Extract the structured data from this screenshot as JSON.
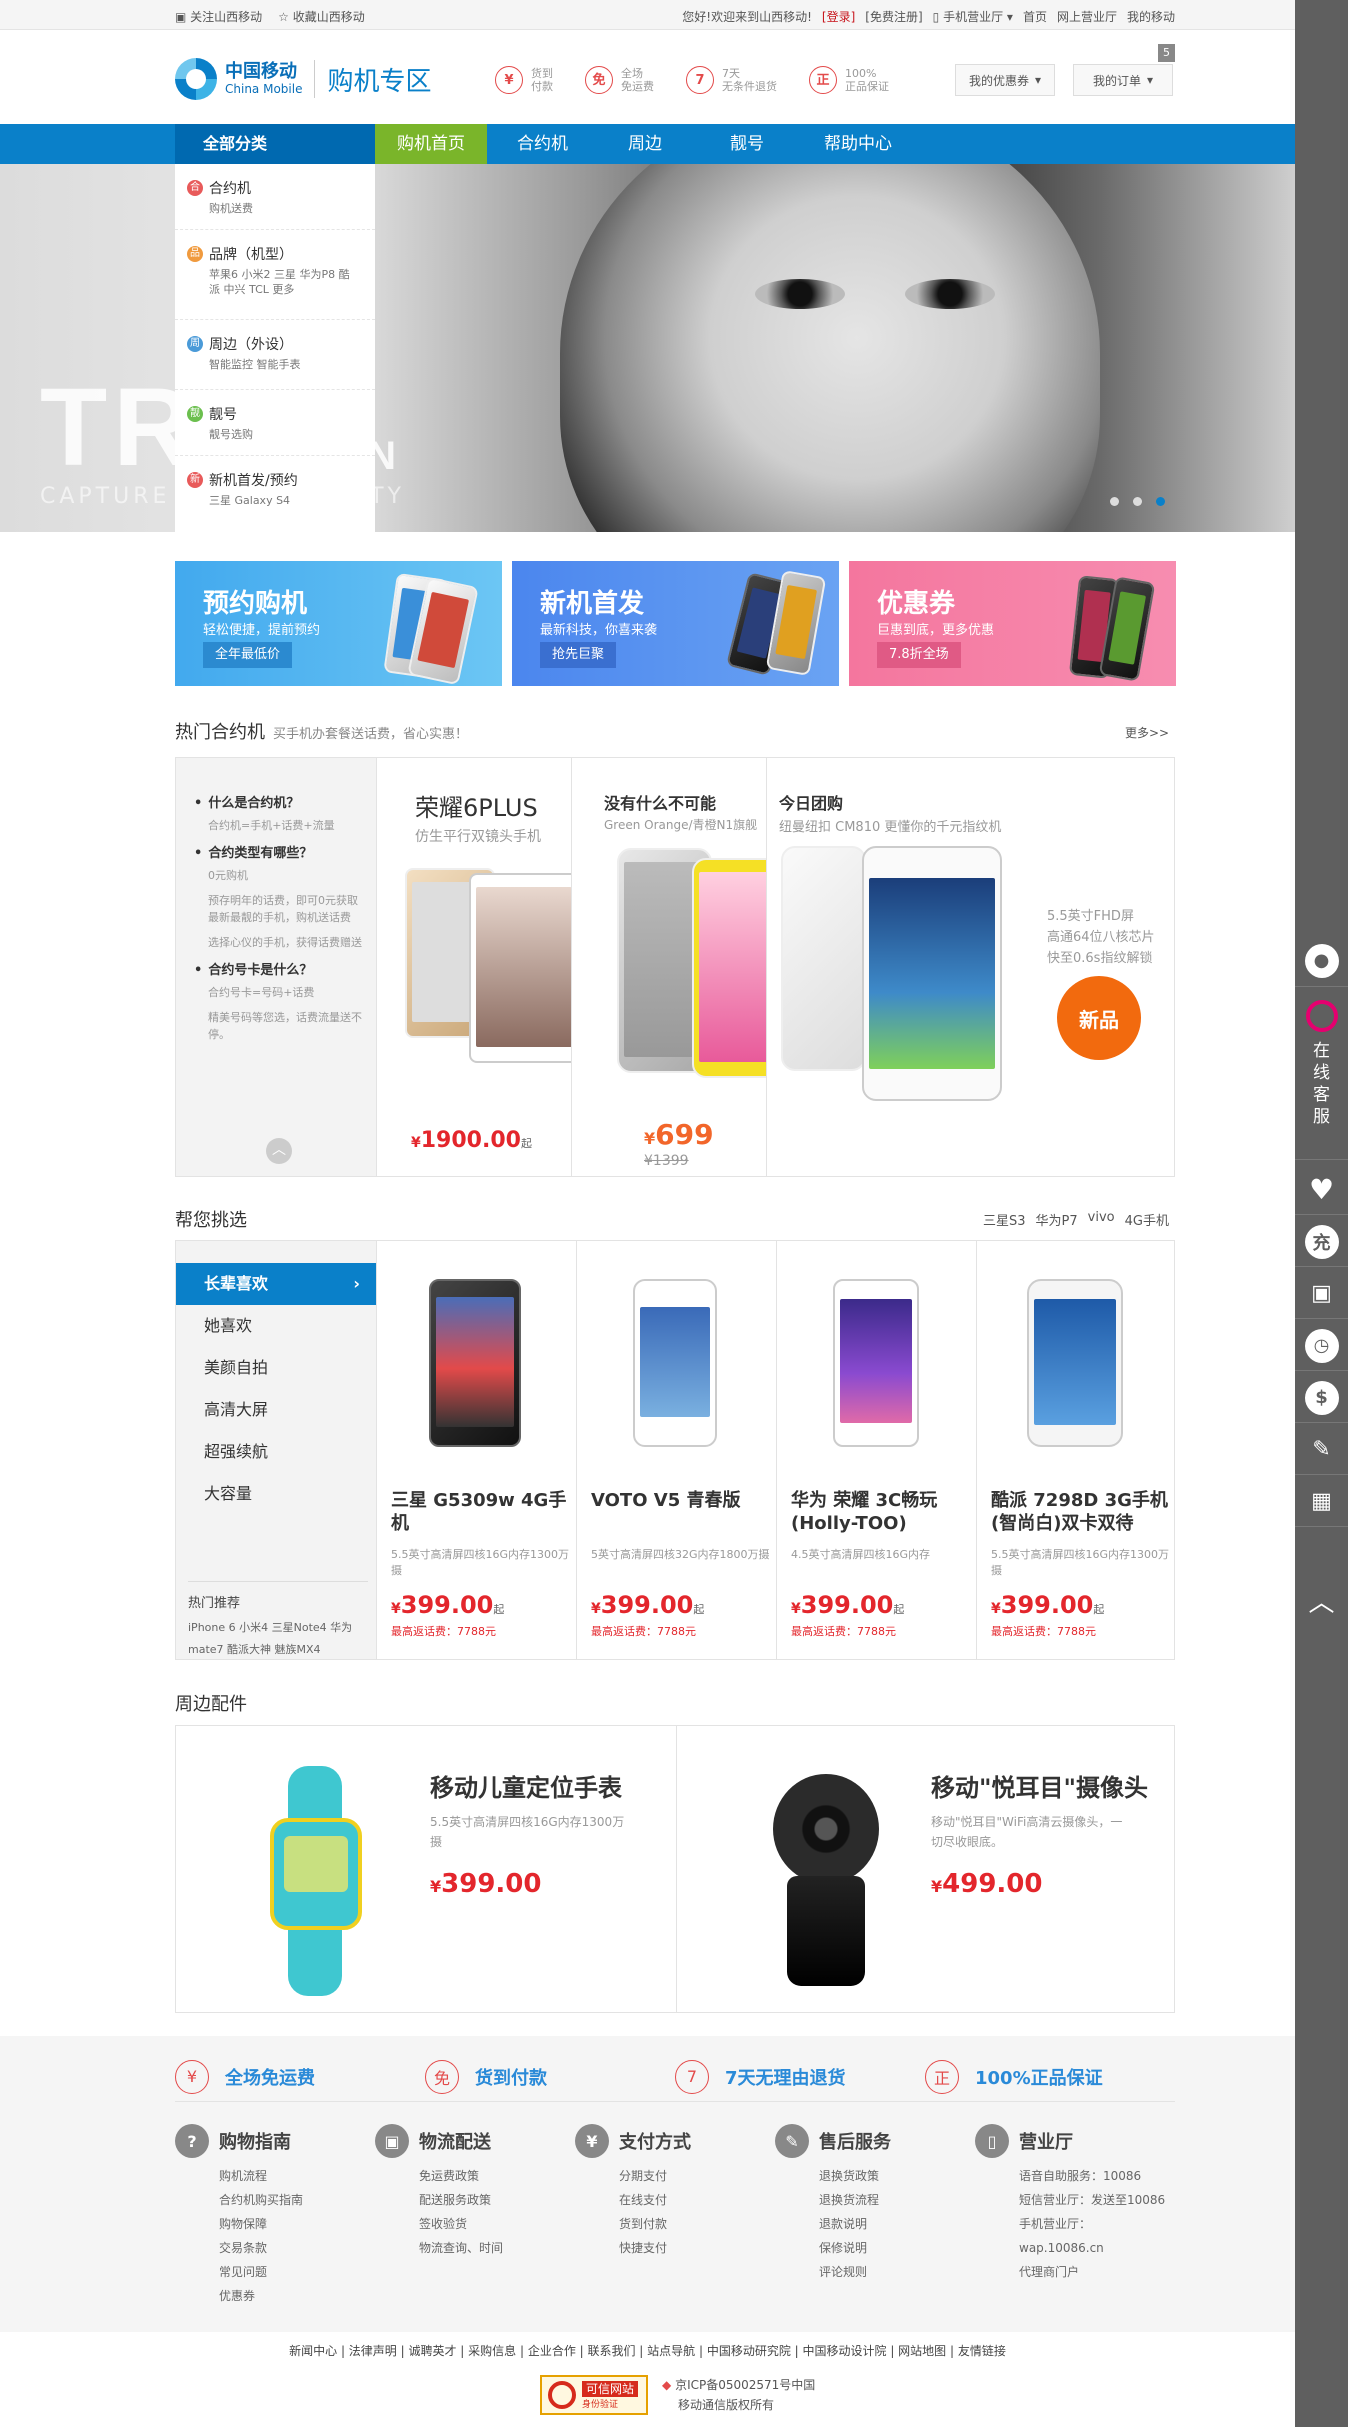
{
  "topbar": {
    "follow": "关注山西移动",
    "favorite": "收藏山西移动",
    "welcome": "您好!欢迎来到山西移动!",
    "login": "[登录]",
    "register": "[免费注册]",
    "mobile_hall": "手机营业厅",
    "home": "首页",
    "online_hall": "网上营业厅",
    "my_mobile": "我的移动"
  },
  "header": {
    "logo_cn": "中国移动",
    "logo_en": "China Mobile",
    "zone": "购机专区",
    "promos": [
      {
        "icon": "¥",
        "l1": "货到",
        "l2": "付款"
      },
      {
        "icon": "免",
        "l1": "全场",
        "l2": "免运费"
      },
      {
        "icon": "7",
        "l1": "7天",
        "l2": "无条件退货"
      },
      {
        "icon": "正",
        "l1": "100%",
        "l2": "正品保证"
      }
    ],
    "coupon_btn": "我的优惠券",
    "order_btn": "我的订单",
    "order_count": "5"
  },
  "nav": {
    "all": "全部分类",
    "items": [
      "购机首页",
      "合约机",
      "周边",
      "靓号",
      "帮助中心"
    ]
  },
  "categories": [
    {
      "icon": "合",
      "color": "#e85a5a",
      "title": "合约机",
      "sub": "购机送费"
    },
    {
      "icon": "品",
      "color": "#f09a3e",
      "title": "品牌（机型）",
      "sub": "苹果6 小米2 三星 华为P8 酷派 中兴 TCL 更多"
    },
    {
      "icon": "周",
      "color": "#4a9ad8",
      "title": "周边（外设）",
      "sub": "智能监控 智能手表"
    },
    {
      "icon": "靓",
      "color": "#6bbf4e",
      "title": "靓号",
      "sub": "靓号选购"
    },
    {
      "icon": "新",
      "color": "#e85a5a",
      "title": "新机首发/预约",
      "sub": "三星 Galaxy S4"
    }
  ],
  "banner": {
    "big": "TRU",
    "big2": "ON",
    "tag": "CAPTURE YO",
    "tag2": "UTY"
  },
  "promo_cards": [
    {
      "title": "预约购机",
      "sub": "轻松便捷，提前预约",
      "btn": "全年最低价"
    },
    {
      "title": "新机首发",
      "sub": "最新科技，你喜来袭",
      "btn": "抢先巨聚"
    },
    {
      "title": "优惠券",
      "sub": "巨惠到底，更多优惠",
      "btn": "7.8折全场"
    }
  ],
  "hot": {
    "title": "热门合约机",
    "subtitle": "买手机办套餐送话费，省心实惠！",
    "more": "更多>>",
    "faq": [
      {
        "q": "什么是合约机？",
        "a": [
          "合约机=手机+话费+流量"
        ]
      },
      {
        "q": "合约类型有哪些？",
        "a": [
          "0元购机",
          "预存明年的话费，即可0元获取最新最靓的手机，购机送话费",
          "选择心仪的手机，获得话费赠送"
        ]
      },
      {
        "q": "合约号卡是什么？",
        "a": [
          "合约号卡=号码+话费",
          "精美号码等您选，话费流量送不停。"
        ]
      }
    ],
    "p1": {
      "name": "荣耀6PLUS",
      "sub": "仿生平行双镜头手机",
      "price": "1900.00",
      "unit": "起"
    },
    "p2": {
      "title": "没有什么不可能",
      "sub": "Green Orange/青橙N1旗舰",
      "price": "699",
      "old": "1399"
    },
    "p3": {
      "title": "今日团购",
      "sub": "纽曼纽扣 CM810 更懂你的千元指纹机",
      "spec": [
        "5.5英寸FHD屏",
        "高通64位八核芯片",
        "快至0.6s指纹解锁"
      ],
      "badge": "新品"
    }
  },
  "pick": {
    "title": "帮您挑选",
    "tags": [
      "三星S3",
      "华为P7",
      "vivo",
      "4G手机"
    ],
    "tabs": [
      "长辈喜欢",
      "她喜欢",
      "美颜自拍",
      "高清大屏",
      "超强续航",
      "大容量"
    ],
    "rec_title": "热门推荐",
    "rec_items": "iPhone 6 小米4 三星Note4 华为mate7 酷派大神 魅族MX4",
    "items": [
      {
        "name": "三星 G5309w 4G手机",
        "desc": "5.5英寸高清屏四核16G内存1300万摄",
        "price": "399.00",
        "ret": "最高返话费：7788元"
      },
      {
        "name": "VOTO V5 青春版",
        "desc": "5英寸高清屏四核32G内存1800万摄",
        "price": "399.00",
        "ret": "最高返话费：7788元"
      },
      {
        "name": "华为 荣耀 3C畅玩 (Holly-TOO)",
        "desc": "4.5英寸高清屏四核16G内存",
        "price": "399.00",
        "ret": "最高返话费：7788元"
      },
      {
        "name": "酷派 7298D 3G手机(智尚白)双卡双待",
        "desc": "5.5英寸高清屏四核16G内存1300万摄",
        "price": "399.00",
        "ret": "最高返话费：7788元"
      }
    ],
    "unit": "起"
  },
  "acc": {
    "title": "周边配件",
    "items": [
      {
        "name": "移动儿童定位手表",
        "desc": "5.5英寸高清屏四核16G内存1300万摄",
        "price": "399.00"
      },
      {
        "name": "移动\"悦耳目\"摄像头",
        "desc": "移动\"悦耳目\"WiFi高清云摄像头，一切尽收眼底。",
        "price": "499.00"
      }
    ]
  },
  "guarantees": [
    {
      "icon": "¥",
      "text": "全场免运费"
    },
    {
      "icon": "免",
      "text": "货到付款"
    },
    {
      "icon": "7",
      "text": "7天无理由退货"
    },
    {
      "icon": "正",
      "text": "100%正品保证"
    }
  ],
  "help": [
    {
      "icon": "?",
      "title": "购物指南",
      "links": [
        "购机流程",
        "合约机购买指南",
        "购物保障",
        "交易条款",
        "常见问题",
        "优惠券"
      ]
    },
    {
      "icon": "▣",
      "title": "物流配送",
      "links": [
        "免运费政策",
        "配送服务政策",
        "签收验货",
        "物流查询、时间"
      ]
    },
    {
      "icon": "¥",
      "title": "支付方式",
      "links": [
        "分期支付",
        "在线支付",
        "货到付款",
        "快捷支付"
      ]
    },
    {
      "icon": "✎",
      "title": "售后服务",
      "links": [
        "退换货政策",
        "退换货流程",
        "退款说明",
        "保修说明",
        "评论规则"
      ]
    },
    {
      "icon": "▯",
      "title": "营业厅",
      "links": [
        "语音自助服务：10086",
        "短信营业厅：发送至10086",
        "手机营业厅：wap.10086.cn",
        "代理商门户"
      ]
    }
  ],
  "footer_links": "新闻中心 | 法律声明 | 诚聘英才 | 采购信息 | 企业合作 | 联系我们 | 站点导航 | 中国移动研究院 | 中国移动设计院 | 网站地图 | 友情链接",
  "credit": {
    "badge": "可信网站",
    "badge2": "身份验证",
    "icp": "京ICP备05002571号中国",
    "rights": "移动通信版权所有"
  },
  "sidebar": {
    "kefu": [
      "在",
      "线",
      "客",
      "服"
    ],
    "charge": "充"
  }
}
